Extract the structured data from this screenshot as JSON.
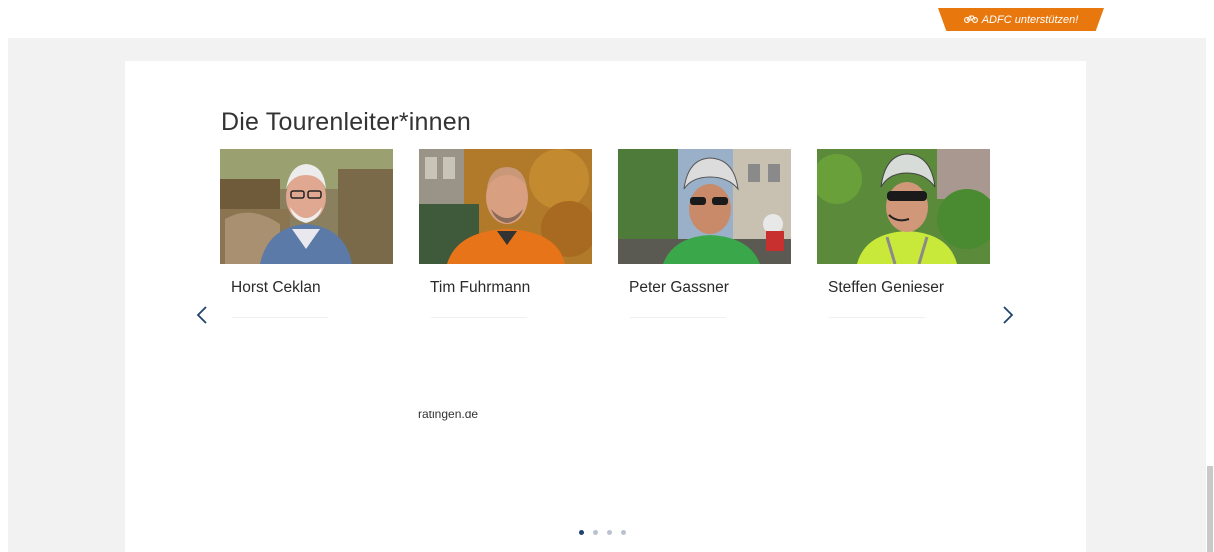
{
  "header": {
    "support_label": "ADFC unterstützen!",
    "support_icon": "bicycle-icon",
    "accent_color": "#e8780e"
  },
  "section": {
    "title": "Die Tourenleiter*innen"
  },
  "guides": [
    {
      "name": "Horst Ceklan"
    },
    {
      "name": "Tim Fuhrmann"
    },
    {
      "name": "Peter Gassner"
    },
    {
      "name": "Steffen Genieser"
    }
  ],
  "carousel": {
    "prev_icon": "chevron-left-icon",
    "next_icon": "chevron-right-icon",
    "page_count": 4,
    "active_page": 1,
    "arrow_color": "#22426e"
  },
  "stray_text": "ratingen.de"
}
